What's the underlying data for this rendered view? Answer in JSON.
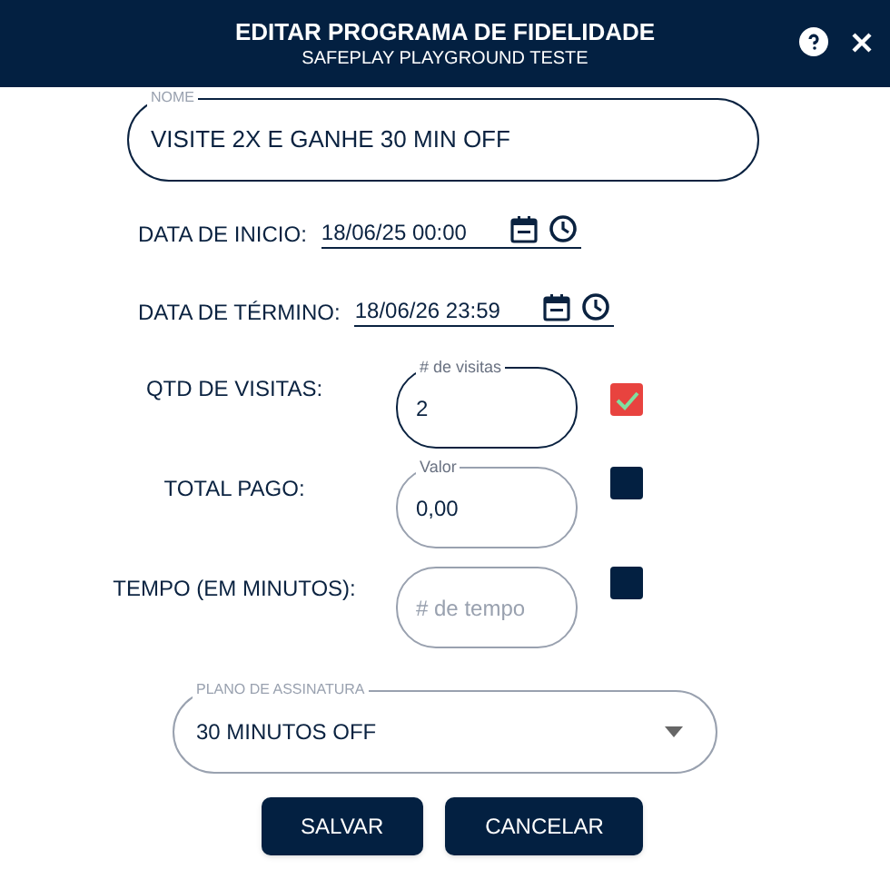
{
  "window": {
    "title": "EDITAR PROGRAMA DE FIDELIDADE",
    "subtitle": "SAFEPLAY PLAYGROUND TESTE"
  },
  "name_field": {
    "label": "NOME",
    "value": "VISITE 2X E GANHE 30 MIN OFF"
  },
  "dates": [
    {
      "label": "DATA DE INICIO:",
      "value": "18/06/25 00:00"
    },
    {
      "label": "DATA DE TÉRMINO:",
      "value": "18/06/26 23:59"
    }
  ],
  "criteria": [
    {
      "label": "QTD DE VISITAS:",
      "field_label": "# de visitas",
      "value": "2",
      "focused": true,
      "checked": true
    },
    {
      "label": "TOTAL PAGO:",
      "field_label": "Valor",
      "value": "0,00",
      "focused": false,
      "checked": false
    },
    {
      "label": "TEMPO (EM MINUTOS):",
      "placeholder": "# de tempo",
      "focused": false,
      "checked": false
    }
  ],
  "plan_select": {
    "label": "PLANO DE ASSINATURA",
    "value": "30 MINUTOS OFF"
  },
  "buttons": [
    "SALVAR",
    "CANCELAR"
  ]
}
